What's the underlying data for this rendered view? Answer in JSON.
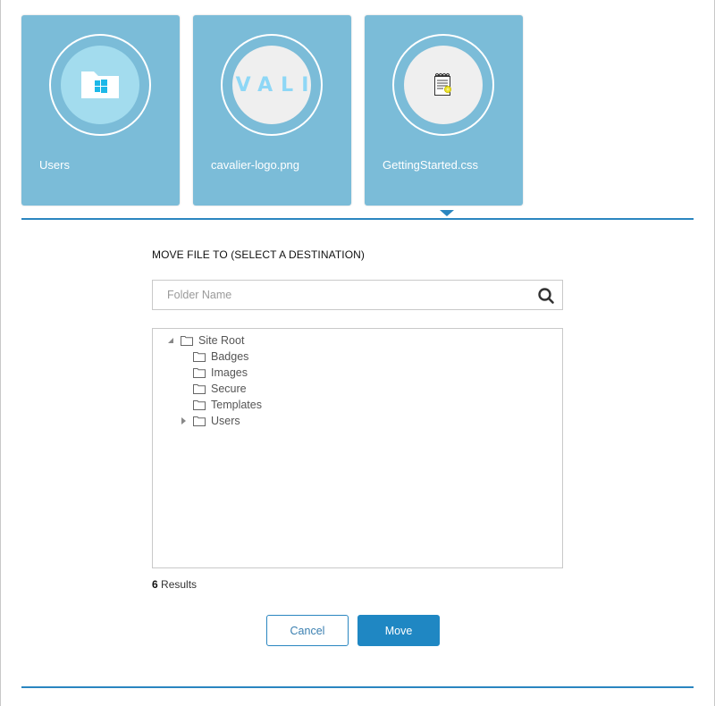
{
  "tiles": [
    {
      "label": "Users",
      "icon": "windows-folder-icon",
      "type": "folder"
    },
    {
      "label": "cavalier-logo.png",
      "icon": "image-thumbnail",
      "thumbnail_text": "VALI",
      "type": "image"
    },
    {
      "label": "GettingStarted.css",
      "icon": "notepad-certificate-icon",
      "type": "file"
    }
  ],
  "dialog": {
    "title": "MOVE FILE TO (SELECT A DESTINATION)",
    "search": {
      "placeholder": "Folder Name",
      "value": "",
      "icon": "search-icon"
    },
    "tree": [
      {
        "label": "Site Root",
        "level": 0,
        "toggle": "expanded"
      },
      {
        "label": "Badges",
        "level": 1,
        "toggle": "none"
      },
      {
        "label": "Images",
        "level": 1,
        "toggle": "none"
      },
      {
        "label": "Secure",
        "level": 1,
        "toggle": "none"
      },
      {
        "label": "Templates",
        "level": 1,
        "toggle": "none"
      },
      {
        "label": "Users",
        "level": 1,
        "toggle": "collapsed"
      }
    ],
    "results_count": "6",
    "results_label": "Results",
    "cancel_label": "Cancel",
    "move_label": "Move"
  },
  "colors": {
    "tile_bg": "#7bbcd8",
    "accent": "#1f87c3",
    "divider": "#2a86c0",
    "logo_text": "#8ed7f6",
    "windows_blue": "#1cb8e8"
  }
}
